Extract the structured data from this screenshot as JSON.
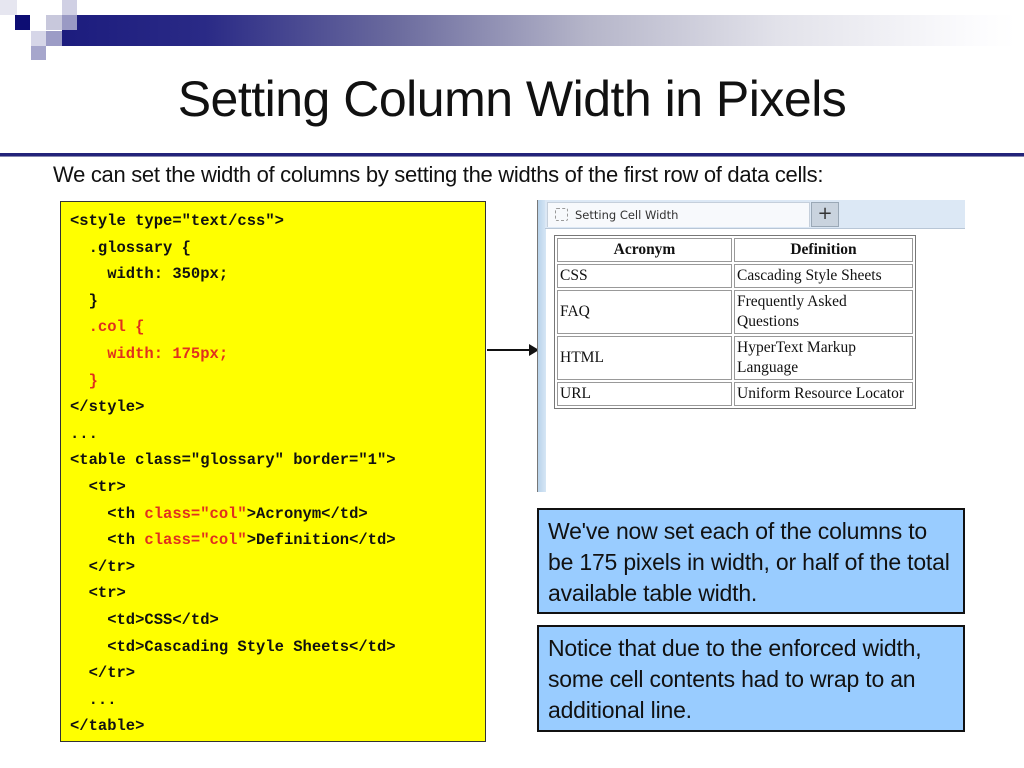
{
  "slide": {
    "title": "Setting Column Width in Pixels",
    "subtitle": "We can set the width of columns by setting the widths of the first row of data cells:"
  },
  "code": {
    "lines": [
      [
        {
          "t": "<style type=\"text/css\">",
          "c": "black"
        }
      ],
      [
        {
          "t": "  .glossary {",
          "c": "black"
        }
      ],
      [
        {
          "t": "    width: 350px;",
          "c": "black"
        }
      ],
      [
        {
          "t": "  }",
          "c": "black"
        }
      ],
      [
        {
          "t": "  .col {",
          "c": "red"
        }
      ],
      [
        {
          "t": "    width: 175px;",
          "c": "red"
        }
      ],
      [
        {
          "t": "  }",
          "c": "red"
        }
      ],
      [
        {
          "t": "</style>",
          "c": "black"
        }
      ],
      [
        {
          "t": "...",
          "c": "black"
        }
      ],
      [
        {
          "t": "<table class=\"glossary\" border=\"1\">",
          "c": "black"
        }
      ],
      [
        {
          "t": "  <tr>",
          "c": "black"
        }
      ],
      [
        {
          "t": "    <th ",
          "c": "black"
        },
        {
          "t": "class=\"col\"",
          "c": "red"
        },
        {
          "t": ">Acronym</td>",
          "c": "black"
        }
      ],
      [
        {
          "t": "    <th ",
          "c": "black"
        },
        {
          "t": "class=\"col\"",
          "c": "red"
        },
        {
          "t": ">Definition</td>",
          "c": "black"
        }
      ],
      [
        {
          "t": "  </tr>",
          "c": "black"
        }
      ],
      [
        {
          "t": "  <tr>",
          "c": "black"
        }
      ],
      [
        {
          "t": "    <td>CSS</td>",
          "c": "black"
        }
      ],
      [
        {
          "t": "    <td>Cascading Style Sheets</td>",
          "c": "black"
        }
      ],
      [
        {
          "t": "  </tr>",
          "c": "black"
        }
      ],
      [
        {
          "t": "  ...",
          "c": "black"
        }
      ],
      [
        {
          "t": "</table>",
          "c": "black"
        }
      ]
    ]
  },
  "browser": {
    "tab_label": "Setting Cell Width",
    "tab_icon": "blank-page-icon",
    "new_tab_label": "+",
    "table": {
      "headers": [
        "Acronym",
        "Definition"
      ],
      "rows": [
        [
          "CSS",
          "Cascading Style Sheets"
        ],
        [
          "FAQ",
          "Frequently Asked Questions"
        ],
        [
          "HTML",
          "HyperText Markup Language"
        ],
        [
          "URL",
          "Uniform Resource Locator"
        ]
      ]
    }
  },
  "notes": [
    "We've now set each of the columns to be 175 pixels in width, or half of the total available table width.",
    "Notice that due to the enforced width, some cell contents had to wrap to an additional line."
  ],
  "colors": {
    "code_background": "#ffff00",
    "code_highlight": "#e0301e",
    "note_background": "#99ccff",
    "header_rule": "#23237a"
  }
}
